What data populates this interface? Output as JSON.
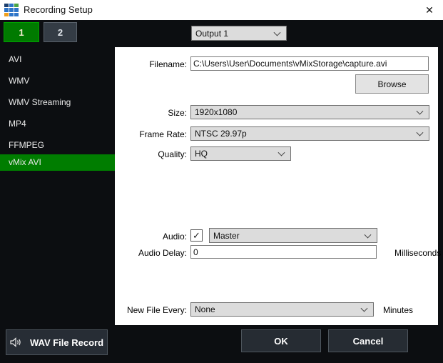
{
  "window": {
    "title": "Recording Setup",
    "close_glyph": "✕"
  },
  "colors": {
    "accent_green": "#007d00",
    "accent_green_border": "#00a300",
    "window_bg": "#0c0e11",
    "titlebar_bg": "#ffffff",
    "panel_bg": "#ffffff",
    "dark_button_bg": "#262c33",
    "dark_button_border": "#4d555d"
  },
  "tabs": [
    {
      "label": "1",
      "selected": true
    },
    {
      "label": "2",
      "selected": false
    }
  ],
  "output_select": {
    "value": "Output 1"
  },
  "sidebar": {
    "items": [
      {
        "label": "AVI",
        "selected": false
      },
      {
        "label": "WMV",
        "selected": false
      },
      {
        "label": "WMV Streaming",
        "selected": false
      },
      {
        "label": "MP4",
        "selected": false
      },
      {
        "label": "FFMPEG",
        "selected": false
      },
      {
        "label": "vMix AVI",
        "selected": true
      }
    ]
  },
  "form": {
    "filename_label": "Filename:",
    "filename_value": "C:\\Users\\User\\Documents\\vMixStorage\\capture.avi",
    "browse_label": "Browse",
    "size_label": "Size:",
    "size_value": "1920x1080",
    "frame_rate_label": "Frame Rate:",
    "frame_rate_value": "NTSC 29.97p",
    "quality_label": "Quality:",
    "quality_value": "HQ",
    "audio_label": "Audio:",
    "audio_checked": true,
    "audio_check_glyph": "✓",
    "audio_value": "Master",
    "audio_delay_label": "Audio Delay:",
    "audio_delay_value": "0",
    "audio_delay_unit": "Milliseconds",
    "new_file_label": "New File Every:",
    "new_file_value": "None",
    "new_file_unit": "Minutes"
  },
  "footer": {
    "wav_label": "WAV File Record",
    "ok_label": "OK",
    "cancel_label": "Cancel"
  }
}
